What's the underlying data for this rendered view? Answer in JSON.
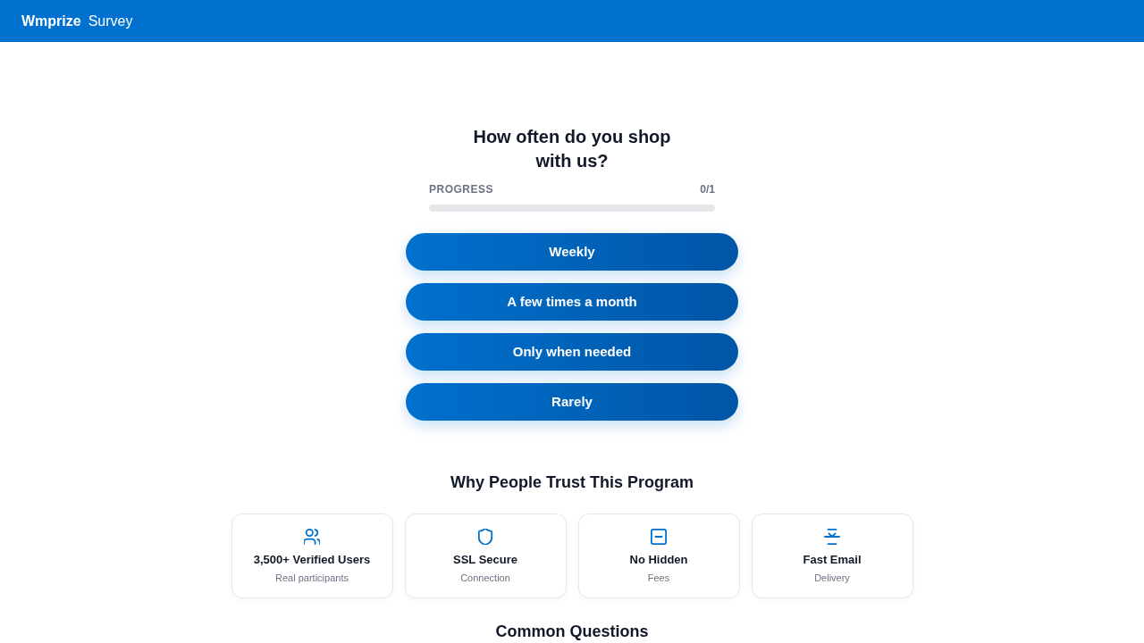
{
  "header": {
    "brand": "Wmprize",
    "title": "Survey"
  },
  "question": {
    "title": "How often do you shop with us?",
    "progress_label": "PROGRESS",
    "progress_count": "0/1",
    "level": 0
  },
  "answers": [
    {
      "label": "Weekly"
    },
    {
      "label": "A few times a month"
    },
    {
      "label": "Only when needed"
    },
    {
      "label": "Rarely"
    }
  ],
  "trust": {
    "heading": "Why People Trust This Program",
    "cards": [
      {
        "kind": "users",
        "title": "3,500+ Verified Users",
        "subtitle": "Real participants"
      },
      {
        "kind": "shield",
        "title": "SSL Secure",
        "subtitle": "Connection"
      },
      {
        "kind": "minus",
        "title": "No Hidden",
        "subtitle": "Fees"
      },
      {
        "kind": "lines",
        "title": "Fast Email",
        "subtitle": "Delivery"
      }
    ]
  },
  "faq": {
    "heading": "Common Questions"
  }
}
